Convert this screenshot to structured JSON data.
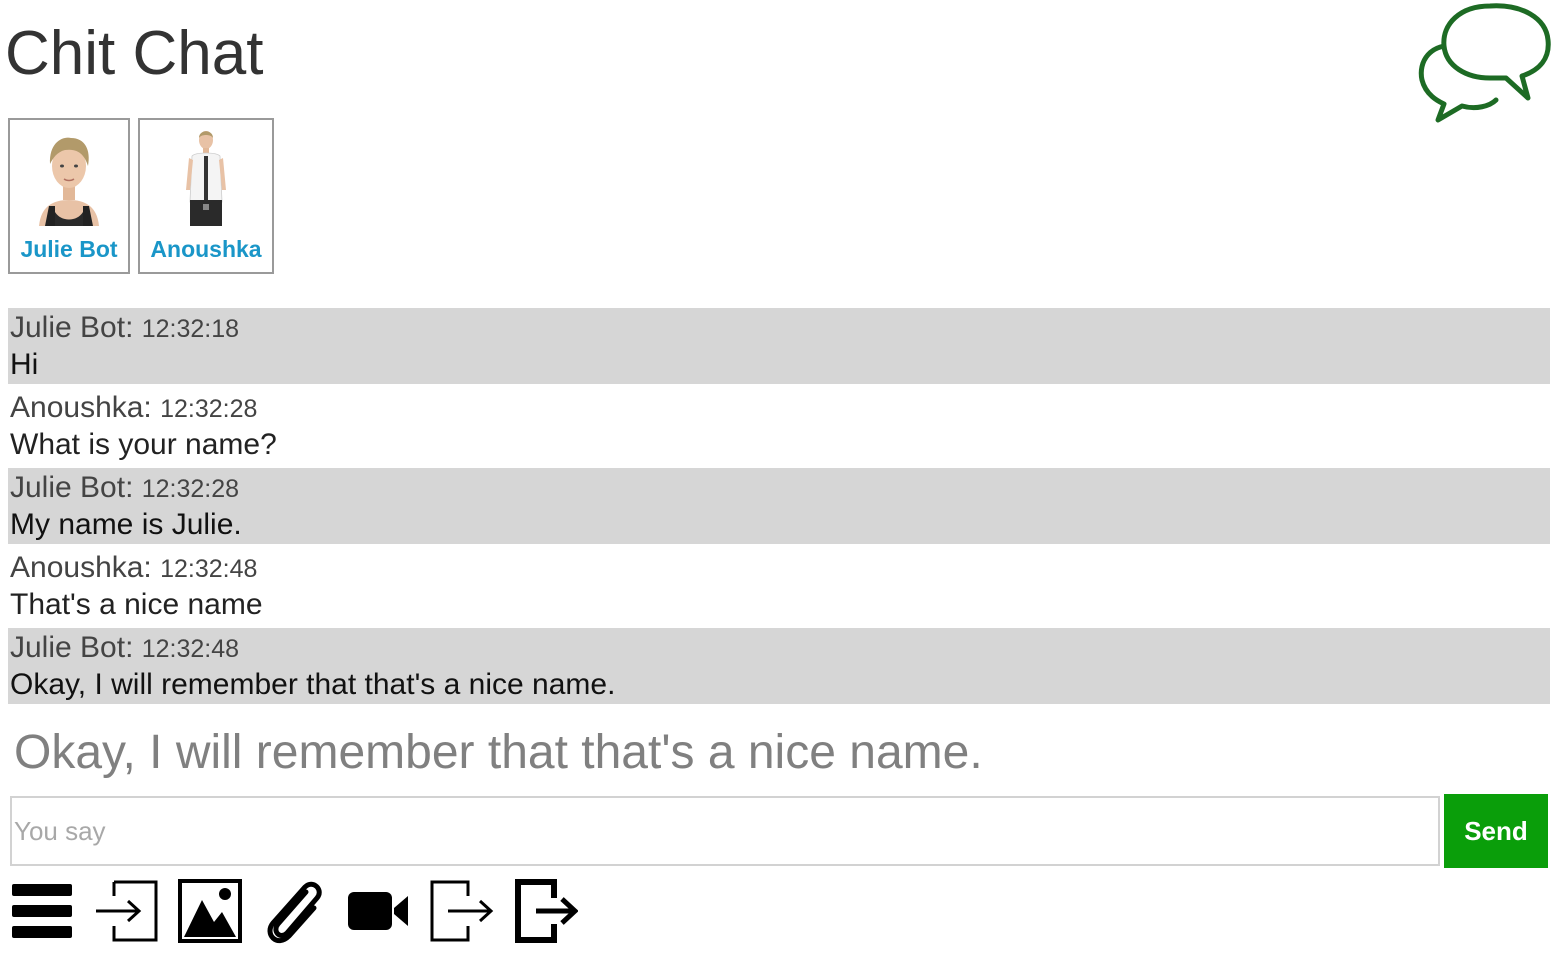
{
  "app": {
    "title": "Chit Chat",
    "logo_icon": "speech-bubbles-icon",
    "accent_color": "#0a9e0a",
    "link_color": "#1a96c8"
  },
  "participants": [
    {
      "name": "Julie Bot",
      "icon": "avatar-julie"
    },
    {
      "name": "Anoushka",
      "icon": "avatar-anoushka"
    }
  ],
  "messages": [
    {
      "speaker": "Julie Bot:",
      "time": "12:32:18",
      "text": "Hi",
      "shaded": true
    },
    {
      "speaker": "Anoushka:",
      "time": "12:32:28",
      "text": "What is your name?",
      "shaded": false
    },
    {
      "speaker": "Julie Bot:",
      "time": "12:32:28",
      "text": "My name is Julie.",
      "shaded": true
    },
    {
      "speaker": "Anoushka:",
      "time": "12:32:48",
      "text": "That's a nice name",
      "shaded": false
    },
    {
      "speaker": "Julie Bot:",
      "time": "12:32:48",
      "text": "Okay, I will remember that that's a nice name.",
      "shaded": true
    }
  ],
  "last_response": "Okay, I will remember that that's a nice name.",
  "input": {
    "placeholder": "You say",
    "value": "",
    "send_label": "Send"
  },
  "toolbar": [
    {
      "icon": "menu-icon"
    },
    {
      "icon": "login-icon"
    },
    {
      "icon": "image-icon"
    },
    {
      "icon": "paperclip-icon"
    },
    {
      "icon": "video-camera-icon"
    },
    {
      "icon": "exit-icon"
    },
    {
      "icon": "logout-icon"
    }
  ]
}
